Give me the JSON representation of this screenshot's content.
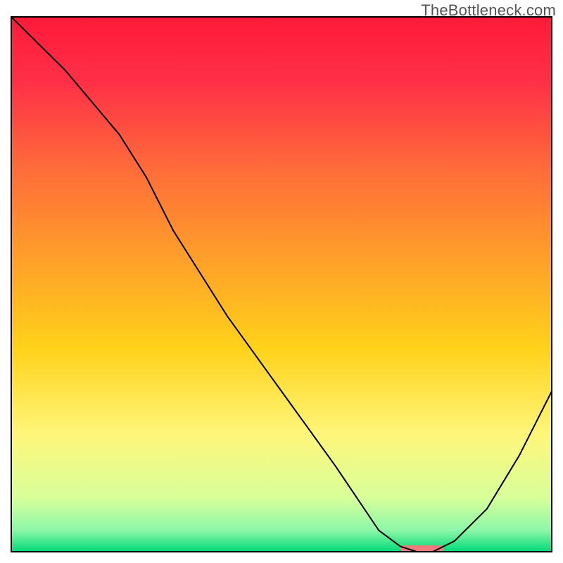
{
  "watermark": "TheBottleneck.com",
  "chart_data": {
    "type": "line",
    "title": "",
    "xlabel": "",
    "ylabel": "",
    "xlim": [
      0,
      100
    ],
    "ylim": [
      0,
      100
    ],
    "grid": false,
    "legend": false,
    "background_gradient_stops": [
      {
        "offset": 0.0,
        "color": "#ff1a3a"
      },
      {
        "offset": 0.12,
        "color": "#ff2f48"
      },
      {
        "offset": 0.28,
        "color": "#ff6a3a"
      },
      {
        "offset": 0.45,
        "color": "#ff9f2a"
      },
      {
        "offset": 0.62,
        "color": "#ffd21a"
      },
      {
        "offset": 0.78,
        "color": "#fff67a"
      },
      {
        "offset": 0.9,
        "color": "#d8ff9a"
      },
      {
        "offset": 0.96,
        "color": "#8cf7a8"
      },
      {
        "offset": 1.0,
        "color": "#00d977"
      }
    ],
    "series": [
      {
        "name": "curve",
        "x": [
          0,
          10,
          20,
          25,
          30,
          40,
          50,
          60,
          68,
          72,
          75,
          78,
          82,
          88,
          94,
          100
        ],
        "values": [
          100,
          90,
          78,
          70,
          60,
          44,
          30,
          16,
          4,
          1,
          0,
          0,
          2,
          8,
          18,
          30
        ]
      }
    ],
    "marker": {
      "name": "highlight-segment",
      "x_start": 72,
      "x_end": 80,
      "y": 0,
      "color": "#ef7a7a",
      "thickness_pct": 1.2
    },
    "frame": {
      "left_pct": 2,
      "right_pct": 98,
      "top_pct": 3,
      "bottom_pct": 98
    }
  }
}
